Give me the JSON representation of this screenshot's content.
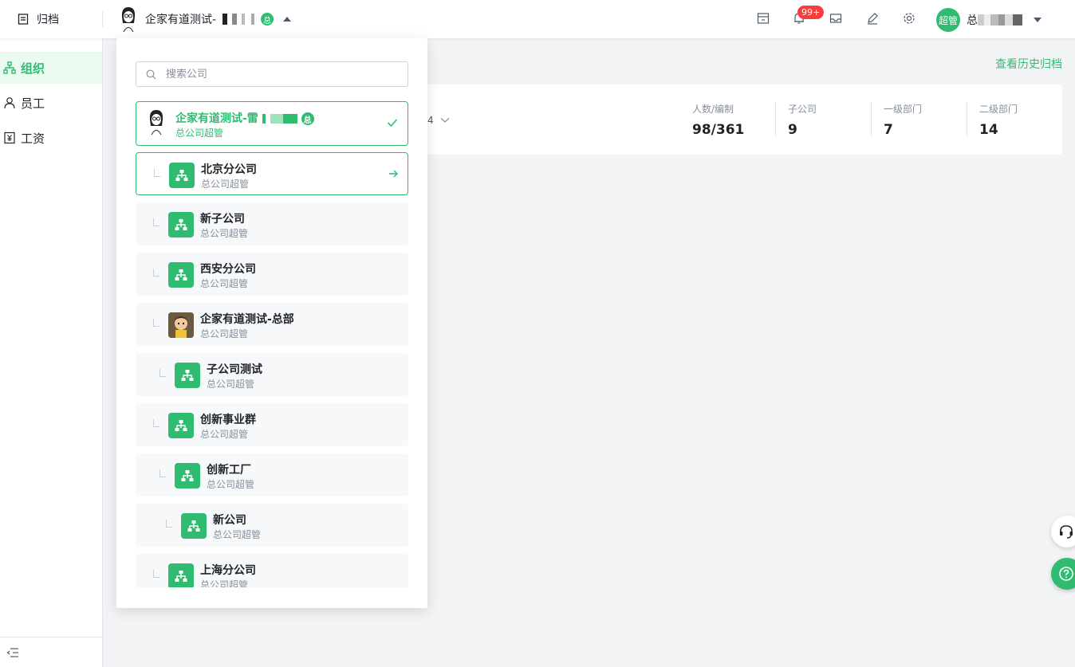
{
  "topbar": {
    "archive_label": "归档",
    "company_name": "企家有道测试-",
    "company_badge": "总",
    "notification_count": "99+",
    "user_avatar_text": "超管",
    "user_name_prefix": "总"
  },
  "sidebar": {
    "items": [
      {
        "label": "组织",
        "icon": "org-icon",
        "active": true
      },
      {
        "label": "员工",
        "icon": "person-icon",
        "active": false
      },
      {
        "label": "工资",
        "icon": "salary-icon",
        "active": false
      }
    ]
  },
  "main": {
    "history_link": "查看历史归档",
    "partial_value": "4",
    "stats": [
      {
        "label": "人数/编制",
        "value": "98/361"
      },
      {
        "label": "子公司",
        "value": "9"
      },
      {
        "label": "一级部门",
        "value": "7"
      },
      {
        "label": "二级部门",
        "value": "14"
      }
    ]
  },
  "dropdown": {
    "search_placeholder": "搜索公司",
    "current": {
      "name": "企家有道测试-雷",
      "badge": "总",
      "role": "总公司超管"
    },
    "items": [
      {
        "name": "北京分公司",
        "role": "总公司超管"
      },
      {
        "name": "新子公司",
        "role": "总公司超管"
      },
      {
        "name": "西安分公司",
        "role": "总公司超管"
      },
      {
        "name": "企家有道测试-总部",
        "role": "总公司超管"
      },
      {
        "name": "子公司测试",
        "role": "总公司超管"
      },
      {
        "name": "创新事业群",
        "role": "总公司超管"
      },
      {
        "name": "创新工厂",
        "role": "总公司超管"
      },
      {
        "name": "新公司",
        "role": "总公司超管"
      },
      {
        "name": "上海分公司",
        "role": "总公司超管"
      }
    ]
  },
  "colors": {
    "accent": "#2fbc71",
    "badge_red": "#f53f3f"
  }
}
